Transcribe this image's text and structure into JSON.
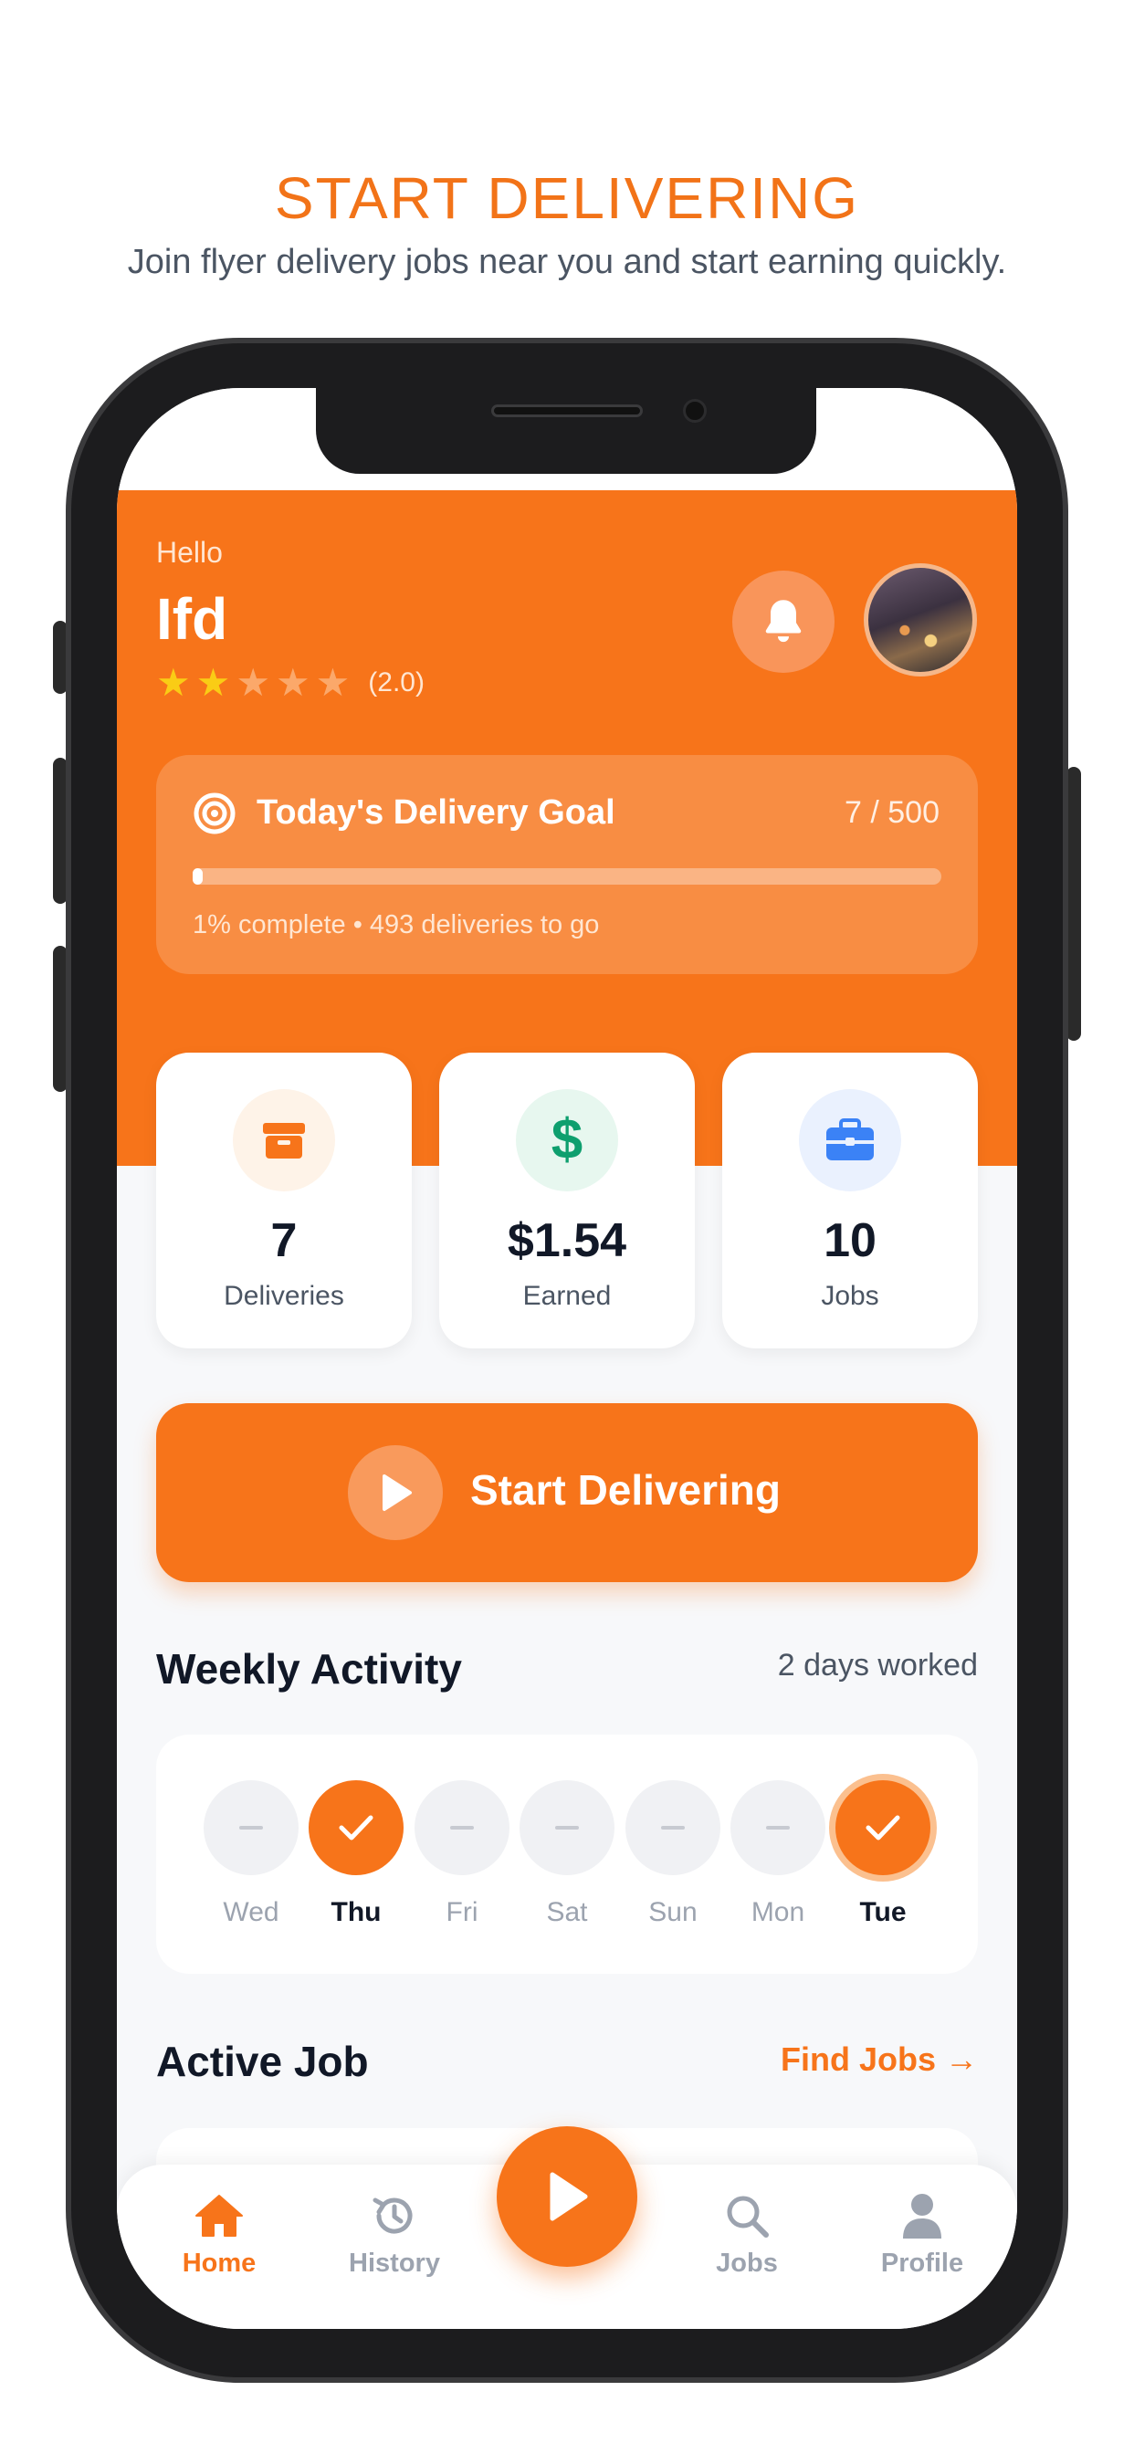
{
  "promo": {
    "title": "START DELIVERING",
    "subtitle": "Join flyer delivery jobs near you and start earning quickly."
  },
  "header": {
    "greeting": "Hello",
    "user_name": "Ifd",
    "rating_stars": 2,
    "rating_max": 5,
    "rating_text": "(2.0)",
    "bell_icon": "bell-icon",
    "avatar_icon": "user-avatar-photo"
  },
  "goal": {
    "icon": "target-icon",
    "title": "Today's Delivery Goal",
    "count": "7 / 500",
    "progress_fraction": 0.014,
    "note": "1% complete • 493 deliveries to go"
  },
  "stats": [
    {
      "icon": "package-icon",
      "value": "7",
      "label": "Deliveries",
      "color": "#F7741A",
      "bg": "#FEF3E8"
    },
    {
      "icon": "dollar-icon",
      "value": "$1.54",
      "label": "Earned",
      "color": "#0E9F6E",
      "bg": "#E7F7EF"
    },
    {
      "icon": "briefcase-icon",
      "value": "10",
      "label": "Jobs",
      "color": "#3B82F6",
      "bg": "#EAF1FE"
    }
  ],
  "cta": {
    "icon": "play-icon",
    "label": "Start Delivering"
  },
  "weekly": {
    "title": "Weekly Activity",
    "meta": "2 days worked",
    "days": [
      {
        "label": "Wed",
        "status": "none"
      },
      {
        "label": "Thu",
        "status": "done"
      },
      {
        "label": "Fri",
        "status": "none"
      },
      {
        "label": "Sat",
        "status": "none"
      },
      {
        "label": "Sun",
        "status": "none"
      },
      {
        "label": "Mon",
        "status": "none"
      },
      {
        "label": "Tue",
        "status": "today"
      }
    ]
  },
  "active_job": {
    "title": "Active Job",
    "link": "Find Jobs →"
  },
  "tabbar": {
    "items": [
      {
        "label": "Home",
        "icon": "home-icon",
        "active": true
      },
      {
        "label": "History",
        "icon": "history-icon",
        "active": false
      },
      {
        "label": "Jobs",
        "icon": "search-icon",
        "active": false
      },
      {
        "label": "Profile",
        "icon": "profile-icon",
        "active": false
      }
    ],
    "fab_icon": "play-icon"
  },
  "colors": {
    "brand": "#F7741A",
    "star": "#FACC15",
    "text": "#111827",
    "muted": "#9CA3AF"
  }
}
